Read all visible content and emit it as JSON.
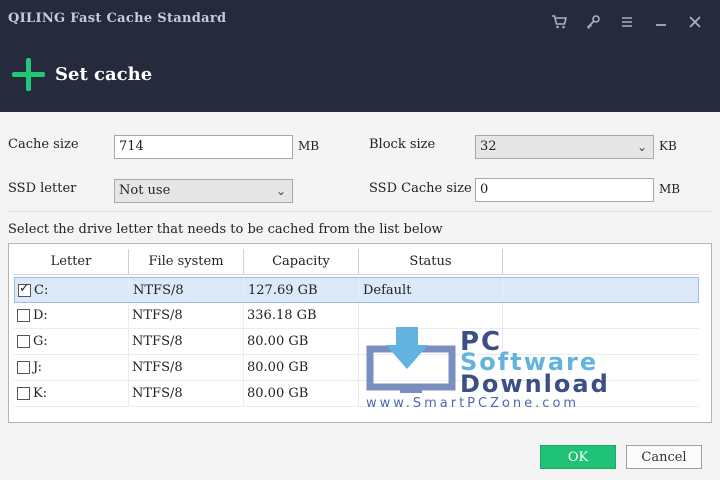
{
  "window": {
    "title": "QILING Fast Cache Standard",
    "controls": [
      "cart-icon",
      "key-icon",
      "menu-icon",
      "minimize-icon",
      "close-icon"
    ]
  },
  "header": {
    "action_label": "Set cache",
    "action_icon": "plus-icon",
    "accent": "#20c875",
    "bg": "#252b3c"
  },
  "form": {
    "cache_size_label": "Cache size",
    "cache_size_value": "714",
    "cache_size_unit": "MB",
    "block_size_label": "Block size",
    "block_size_value": "32",
    "block_size_unit": "KB",
    "ssd_letter_label": "SSD letter",
    "ssd_letter_value": "Not use",
    "ssd_cache_size_label": "SSD Cache size",
    "ssd_cache_size_value": "0",
    "ssd_cache_size_unit": "MB"
  },
  "hint": "Select the drive letter that needs to be cached from the list below",
  "table": {
    "headers": [
      "Letter",
      "File system",
      "Capacity",
      "Status"
    ],
    "rows": [
      {
        "checked": true,
        "letter": "C:",
        "fs": "NTFS/8",
        "capacity": "127.69 GB",
        "status": "Default"
      },
      {
        "checked": false,
        "letter": "D:",
        "fs": "NTFS/8",
        "capacity": "336.18 GB",
        "status": ""
      },
      {
        "checked": false,
        "letter": "G:",
        "fs": "NTFS/8",
        "capacity": "80.00 GB",
        "status": ""
      },
      {
        "checked": false,
        "letter": "J:",
        "fs": "NTFS/8",
        "capacity": "80.00 GB",
        "status": ""
      },
      {
        "checked": false,
        "letter": "K:",
        "fs": "NTFS/8",
        "capacity": "80.00 GB",
        "status": ""
      }
    ]
  },
  "watermark": {
    "line1": "PC",
    "line2": "Software",
    "line3": "Download",
    "url": "www.SmartPCZone.com"
  },
  "buttons": {
    "ok": "OK",
    "cancel": "Cancel"
  }
}
